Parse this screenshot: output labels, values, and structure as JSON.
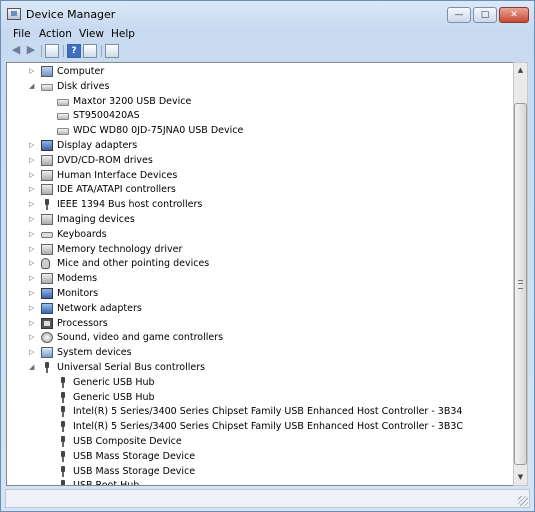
{
  "window": {
    "title": "Device Manager",
    "buttons": {
      "minimize": "—",
      "maximize": "□",
      "close": "✕"
    }
  },
  "menu": [
    "File",
    "Action",
    "View",
    "Help"
  ],
  "toolbar": {
    "back_icon": "◀",
    "forward_icon": "▶",
    "help_icon": "?"
  },
  "tree": [
    {
      "label": "Computer",
      "level": 0,
      "state": "collapsed",
      "icon": "computer-icon"
    },
    {
      "label": "Disk drives",
      "level": 0,
      "state": "expanded",
      "icon": "disk-icon"
    },
    {
      "label": "Maxtor 3200 USB Device",
      "level": 1,
      "state": "none",
      "icon": "disk-icon"
    },
    {
      "label": "ST9500420AS",
      "level": 1,
      "state": "none",
      "icon": "disk-icon"
    },
    {
      "label": "WDC WD80 0JD-75JNA0 USB Device",
      "level": 1,
      "state": "none",
      "icon": "disk-icon"
    },
    {
      "label": "Display adapters",
      "level": 0,
      "state": "collapsed",
      "icon": "display-icon"
    },
    {
      "label": "DVD/CD-ROM drives",
      "level": 0,
      "state": "collapsed",
      "icon": "cdrom-icon"
    },
    {
      "label": "Human Interface Devices",
      "level": 0,
      "state": "collapsed",
      "icon": "hid-icon"
    },
    {
      "label": "IDE ATA/ATAPI controllers",
      "level": 0,
      "state": "collapsed",
      "icon": "ide-icon"
    },
    {
      "label": "IEEE 1394 Bus host controllers",
      "level": 0,
      "state": "collapsed",
      "icon": "plug-icon"
    },
    {
      "label": "Imaging devices",
      "level": 0,
      "state": "collapsed",
      "icon": "camera-icon"
    },
    {
      "label": "Keyboards",
      "level": 0,
      "state": "collapsed",
      "icon": "keyboard-icon"
    },
    {
      "label": "Memory technology driver",
      "level": 0,
      "state": "collapsed",
      "icon": "memory-icon"
    },
    {
      "label": "Mice and other pointing devices",
      "level": 0,
      "state": "collapsed",
      "icon": "mouse-icon"
    },
    {
      "label": "Modems",
      "level": 0,
      "state": "collapsed",
      "icon": "modem-icon"
    },
    {
      "label": "Monitors",
      "level": 0,
      "state": "collapsed",
      "icon": "monitor-icon"
    },
    {
      "label": "Network adapters",
      "level": 0,
      "state": "collapsed",
      "icon": "network-icon"
    },
    {
      "label": "Processors",
      "level": 0,
      "state": "collapsed",
      "icon": "processor-icon"
    },
    {
      "label": "Sound, video and game controllers",
      "level": 0,
      "state": "collapsed",
      "icon": "sound-icon"
    },
    {
      "label": "System devices",
      "level": 0,
      "state": "collapsed",
      "icon": "system-icon"
    },
    {
      "label": "Universal Serial Bus controllers",
      "level": 0,
      "state": "expanded",
      "icon": "usb-icon"
    },
    {
      "label": "Generic USB Hub",
      "level": 1,
      "state": "none",
      "icon": "usb-icon"
    },
    {
      "label": "Generic USB Hub",
      "level": 1,
      "state": "none",
      "icon": "usb-icon"
    },
    {
      "label": "Intel(R) 5 Series/3400 Series Chipset Family USB Enhanced Host Controller - 3B34",
      "level": 1,
      "state": "none",
      "icon": "usb-icon"
    },
    {
      "label": "Intel(R) 5 Series/3400 Series Chipset Family USB Enhanced Host Controller - 3B3C",
      "level": 1,
      "state": "none",
      "icon": "usb-icon"
    },
    {
      "label": "USB Composite Device",
      "level": 1,
      "state": "none",
      "icon": "usb-icon"
    },
    {
      "label": "USB Mass Storage Device",
      "level": 1,
      "state": "none",
      "icon": "usb-icon"
    },
    {
      "label": "USB Mass Storage Device",
      "level": 1,
      "state": "none",
      "icon": "usb-icon"
    },
    {
      "label": "USB Root Hub",
      "level": 1,
      "state": "none",
      "icon": "usb-icon"
    }
  ],
  "scrollbar": {
    "up_icon": "▲",
    "down_icon": "▼"
  }
}
